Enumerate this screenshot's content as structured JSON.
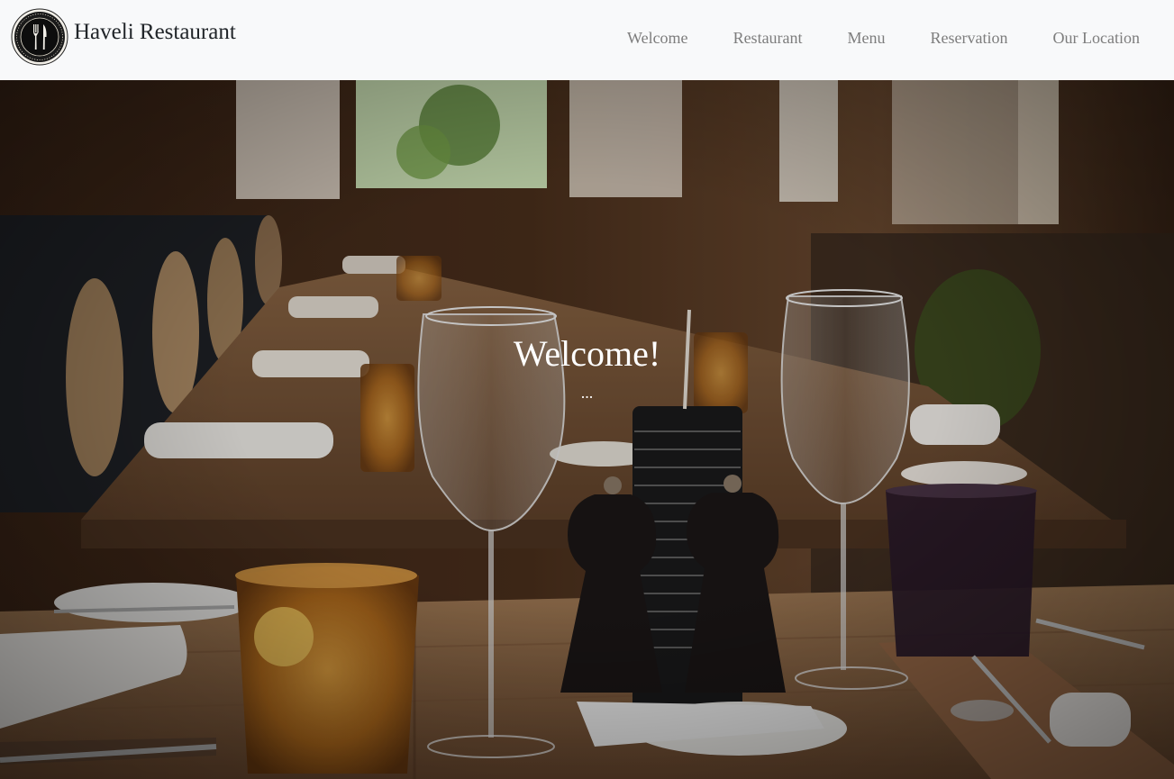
{
  "navbar": {
    "brand_name": "Haveli Restaurant",
    "links": [
      {
        "label": "Welcome"
      },
      {
        "label": "Restaurant"
      },
      {
        "label": "Menu"
      },
      {
        "label": "Reservation"
      },
      {
        "label": "Our Location"
      }
    ]
  },
  "hero": {
    "title": "Welcome!",
    "subtitle": "..."
  },
  "colors": {
    "navbar_bg": "#f8f9fa",
    "nav_link": "#7d7d7d",
    "brand_text": "#212529",
    "hero_text": "#ffffff"
  },
  "icons": {
    "logo": "fork-knife-plate-icon"
  }
}
